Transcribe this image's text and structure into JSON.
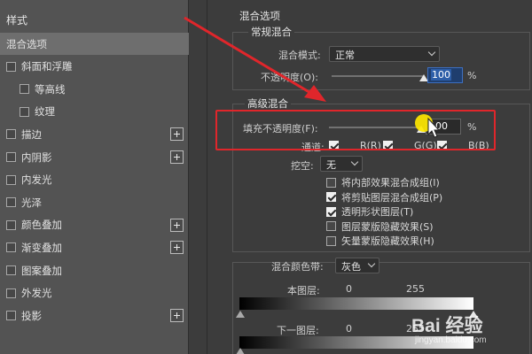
{
  "styles_panel": {
    "title": "样式",
    "items": [
      {
        "label": "混合选项",
        "selected": true,
        "has_checkbox": false,
        "has_plus": false,
        "indent": 0
      },
      {
        "label": "斜面和浮雕",
        "has_checkbox": true,
        "has_plus": false,
        "indent": 0
      },
      {
        "label": "等高线",
        "has_checkbox": true,
        "has_plus": false,
        "indent": 1
      },
      {
        "label": "纹理",
        "has_checkbox": true,
        "has_plus": false,
        "indent": 1
      },
      {
        "label": "描边",
        "has_checkbox": true,
        "has_plus": true,
        "indent": 0
      },
      {
        "label": "内阴影",
        "has_checkbox": true,
        "has_plus": true,
        "indent": 0
      },
      {
        "label": "内发光",
        "has_checkbox": true,
        "has_plus": false,
        "indent": 0
      },
      {
        "label": "光泽",
        "has_checkbox": true,
        "has_plus": false,
        "indent": 0
      },
      {
        "label": "颜色叠加",
        "has_checkbox": true,
        "has_plus": true,
        "indent": 0
      },
      {
        "label": "渐变叠加",
        "has_checkbox": true,
        "has_plus": true,
        "indent": 0
      },
      {
        "label": "图案叠加",
        "has_checkbox": true,
        "has_plus": false,
        "indent": 0
      },
      {
        "label": "外发光",
        "has_checkbox": true,
        "has_plus": false,
        "indent": 0
      },
      {
        "label": "投影",
        "has_checkbox": true,
        "has_plus": true,
        "indent": 0
      }
    ]
  },
  "blend_options": {
    "title": "混合选项",
    "general": {
      "title": "常规混合",
      "mode_label": "混合模式:",
      "mode_value": "正常",
      "opacity_label": "不透明度(O):",
      "opacity_value": "100",
      "opacity_level": 1.0,
      "unit": "%"
    },
    "advanced": {
      "title": "高级混合",
      "fill_label": "填充不透明度(F):",
      "fill_value": "100",
      "fill_level": 1.0,
      "unit": "%",
      "channels_label": "通道:",
      "channels": [
        {
          "label": "R(R)",
          "checked": true
        },
        {
          "label": "G(G)",
          "checked": true
        },
        {
          "label": "B(B)",
          "checked": true
        }
      ],
      "knockout_label": "挖空:",
      "knockout_value": "无",
      "options": [
        {
          "label": "将内部效果混合成组(I)",
          "checked": false
        },
        {
          "label": "将剪贴图层混合成组(P)",
          "checked": true
        },
        {
          "label": "透明形状图层(T)",
          "checked": true
        },
        {
          "label": "图层蒙版隐藏效果(S)",
          "checked": false
        },
        {
          "label": "矢量蒙版隐藏效果(H)",
          "checked": false
        }
      ]
    },
    "blend_if": {
      "label": "混合颜色带:",
      "value": "灰色",
      "this_layer_label": "本图层:",
      "this_layer_low": "0",
      "this_layer_high": "255",
      "underlying_label": "下一图层:",
      "underlying_low": "0",
      "underlying_high": "255"
    }
  },
  "annotation": {
    "box_color": "#e0262b",
    "arrow_color": "#e0262b",
    "cursor_highlight": "#ffe800"
  },
  "watermark": {
    "brand": "Bai 经验",
    "url": "jingyan.baidu.com"
  },
  "colors": {
    "panel_left": "#535353",
    "panel_right": "#3c3c3c",
    "highlight_input": "#2d5ea8"
  }
}
